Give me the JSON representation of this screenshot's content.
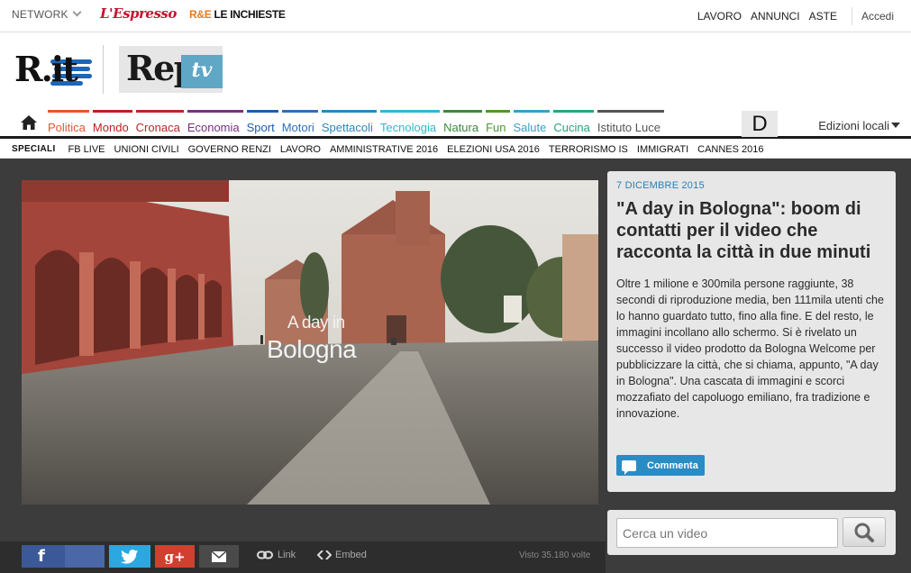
{
  "topbar": {
    "network_label": "NETWORK",
    "espresso": "L'Espresso",
    "inchieste_mark": "R&E",
    "inchieste": "LE INCHIESTE",
    "links": [
      "LAVORO",
      "ANNUNCI",
      "ASTE"
    ],
    "login": "Accedi"
  },
  "logos": {
    "rit": "R.it",
    "rep": "Rep",
    "tv": "tv"
  },
  "nav": {
    "items": [
      {
        "label": "Politica",
        "color": "#e4572e"
      },
      {
        "label": "Mondo",
        "color": "#c0201f"
      },
      {
        "label": "Cronaca",
        "color": "#b8282a"
      },
      {
        "label": "Economia",
        "color": "#7b2f83"
      },
      {
        "label": "Sport",
        "color": "#1d5fa8"
      },
      {
        "label": "Motori",
        "color": "#2f6fb4"
      },
      {
        "label": "Spettacoli",
        "color": "#2a88b8"
      },
      {
        "label": "Tecnologia",
        "color": "#33b6d3"
      },
      {
        "label": "Natura",
        "color": "#3c8a3f"
      },
      {
        "label": "Fun",
        "color": "#4c9a2a"
      },
      {
        "label": "Salute",
        "color": "#3aa0c8"
      },
      {
        "label": "Cucina",
        "color": "#27a57f"
      },
      {
        "label": "Istituto Luce",
        "color": "#555555"
      }
    ],
    "d_label": "D",
    "edizioni": "Edizioni locali"
  },
  "speciali": {
    "label": "SPECIALI",
    "items": [
      "FB LIVE",
      "UNIONI CIVILI",
      "GOVERNO RENZI",
      "LAVORO",
      "AMMINISTRATIVE 2016",
      "ELEZIONI USA 2016",
      "TERRORISMO IS",
      "IMMIGRATI",
      "CANNES 2016"
    ]
  },
  "video": {
    "title_line1": "A day in",
    "title_line2": "Bologna",
    "views": "Visto 35.180 volte"
  },
  "article": {
    "date": "7 DICEMBRE 2015",
    "headline": "\"A day in Bologna\": boom di contatti per il video che racconta la città in due minuti",
    "body": "Oltre 1 milione e 300mila persone raggiunte, 38 secondi di riproduzione media, ben 111mila utenti che lo hanno guardato tutto, fino alla fine. E del resto, le immagini incollano allo schermo. Si è rivelato un successo il video prodotto da Bologna Welcome per pubblicizzare la città, che si chiama, appunto, \"A day in Bologna\". Una cascata di immagini e scorci mozzafiato del capoluogo emiliano, fra tradizione e innovazione.",
    "comment_label": "Commenta"
  },
  "search": {
    "placeholder": "Cerca un video"
  },
  "share": {
    "fb": "f",
    "gplus": "g+",
    "link": "Link",
    "embed": "Embed"
  }
}
